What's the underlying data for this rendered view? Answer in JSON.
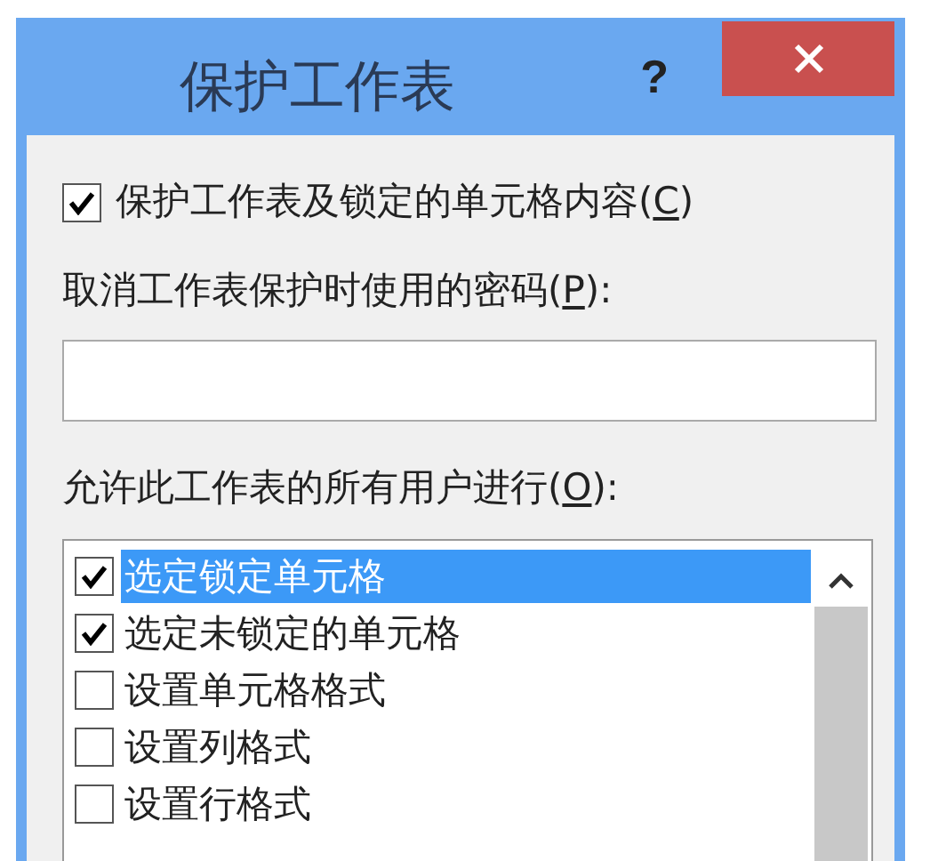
{
  "window": {
    "title": "保护工作表",
    "help": "?"
  },
  "protect": {
    "checked": true,
    "before": "保护工作表及锁定的单元格内容(",
    "mnemonic": "C",
    "after": ")"
  },
  "password": {
    "before": "取消工作表保护时使用的密码(",
    "mnemonic": "P",
    "after": "):"
  },
  "allow": {
    "before": "允许此工作表的所有用户进行(",
    "mnemonic": "O",
    "after": "):"
  },
  "options": [
    {
      "label": "选定锁定单元格",
      "checked": true,
      "selected": true
    },
    {
      "label": "选定未锁定的单元格",
      "checked": true,
      "selected": false
    },
    {
      "label": "设置单元格格式",
      "checked": false,
      "selected": false
    },
    {
      "label": "设置列格式",
      "checked": false,
      "selected": false
    },
    {
      "label": "设置行格式",
      "checked": false,
      "selected": false
    }
  ]
}
